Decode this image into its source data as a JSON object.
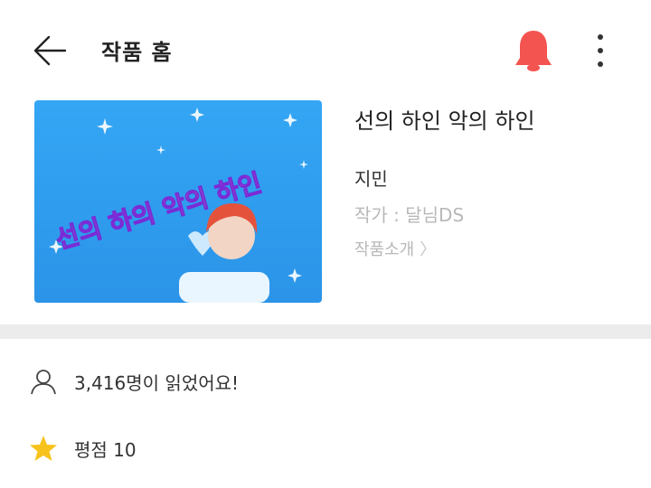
{
  "header": {
    "title": "작품 홈",
    "back_icon": "back-arrow-icon",
    "notify_icon": "bell-icon",
    "more_icon": "more-vertical-icon",
    "notify_color": "#f4544f"
  },
  "work": {
    "title": "선의 하인 악의 하인",
    "cover_text": "선의 하의 악의 하인",
    "character": "지민",
    "author": "작가 : 달님DS",
    "intro_label": "작품소개",
    "cover_bg": "#2b9df0"
  },
  "stats": {
    "reads": "3,416명이 읽었어요!",
    "rating": "평점 10",
    "reads_icon": "user-icon",
    "rating_icon": "star-icon",
    "star_color": "#f7c21c"
  }
}
